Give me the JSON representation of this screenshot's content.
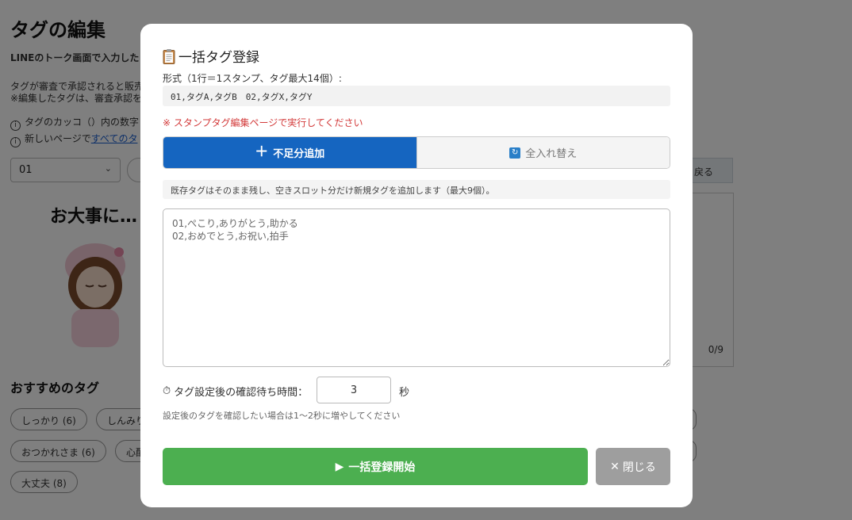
{
  "background": {
    "title": "タグの編集",
    "intro": "LINEのトーク画面で入力した",
    "notice1": "タグが審査で承認されると販売",
    "notice2": "※編集したタグは、審査承認を",
    "info1": "タグのカッコ（）内の数字",
    "info2_prefix": "新しいページで",
    "info2_link": "すべてのタ",
    "sticker_select": "01",
    "sticker_label": "お大事に…",
    "back_button": "戻る",
    "tag_count": "0/9",
    "recommended_title": "おすすめのタグ",
    "chips": [
      "しっかり (6)",
      "しんみり",
      "おつかれさま (6)",
      "心配",
      "大丈夫 (8)"
    ]
  },
  "modal": {
    "title": "一括タグ登録",
    "title_icon": "clipboard-icon",
    "format_label": "形式（1行＝1スタンプ、タグ最大14個）:",
    "format_example": "01,タグA,タグB　02,タグX,タグY",
    "warning": "※ スタンプタグ編集ページで実行してください",
    "mode_add_label": "不足分追加",
    "mode_replace_label": "全入れ替え",
    "mode_description": "既存タグはそのまま残し、空きスロット分だけ新規タグを追加します（最大9個）。",
    "textarea_placeholder": "01,ぺこり,ありがとう,助かる\n02,おめでとう,お祝い,拍手",
    "wait_label": "タグ設定後の確認待ち時間：",
    "wait_value": "3",
    "wait_unit": "秒",
    "hint": "設定後のタグを確認したい場合は1〜2秒に増やしてください",
    "start_label": "一括登録開始",
    "close_label": "閉じる"
  },
  "colors": {
    "primary": "#1565c0",
    "success": "#4caf50",
    "warning": "#d33a3a",
    "close": "#9e9e9e"
  }
}
